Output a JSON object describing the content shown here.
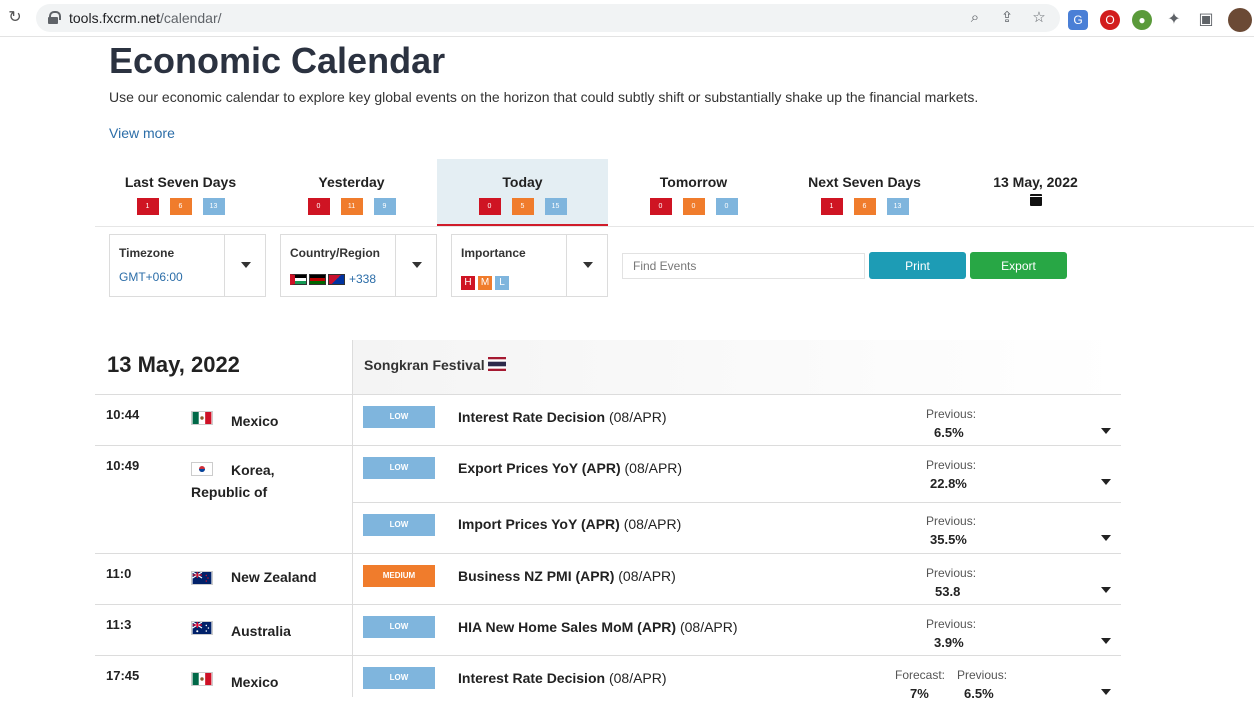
{
  "browser": {
    "url_host": "tools.fxcrm.net",
    "url_path": "/calendar/"
  },
  "page": {
    "title": "Economic Calendar",
    "intro": "Use our economic calendar to explore key global events on the horizon that could subtly shift or substantially shake up the financial markets.",
    "view_more": "View more"
  },
  "tabs": [
    {
      "label": "Last Seven Days",
      "high": "1",
      "medium": "6",
      "low": "13"
    },
    {
      "label": "Yesterday",
      "high": "0",
      "medium": "11",
      "low": "9"
    },
    {
      "label": "Today",
      "high": "0",
      "medium": "5",
      "low": "15",
      "active": true
    },
    {
      "label": "Tomorrow",
      "high": "0",
      "medium": "0",
      "low": "0"
    },
    {
      "label": "Next Seven Days",
      "high": "1",
      "medium": "6",
      "low": "13"
    },
    {
      "label": "13 May, 2022"
    }
  ],
  "filters": {
    "timezone_label": "Timezone",
    "timezone_value": "GMT+06:00",
    "country_label": "Country/Region",
    "country_more": "+338",
    "importance_label": "Importance",
    "importance_badges": [
      "H",
      "M",
      "L"
    ]
  },
  "search": {
    "placeholder": "Find Events"
  },
  "buttons": {
    "print": "Print",
    "export": "Export"
  },
  "calendar": {
    "date": "13 May, 2022",
    "holiday": "Songkran Festival"
  },
  "colors": {
    "high": "#cf1423",
    "medium": "#f07c2c",
    "low": "#7fb5dd",
    "accent_blue": "#2b6da8",
    "print": "#1d9cb5",
    "export": "#28a745"
  },
  "events": [
    {
      "time": "10:44",
      "country": "Mexico",
      "flag": "mexico-flag",
      "importance": "LOW",
      "name": "Interest Rate Decision",
      "period": "(08/APR)",
      "previous_label": "Previous:",
      "previous": "6.5%"
    },
    {
      "time": "10:49",
      "country": "Korea, Republic of",
      "flag": "korea-flag",
      "importance": "LOW",
      "name": "Export Prices YoY (APR)",
      "period": "(08/APR)",
      "previous_label": "Previous:",
      "previous": "22.8%"
    },
    {
      "time": "",
      "country": "",
      "flag": "",
      "importance": "LOW",
      "name": "Import Prices YoY (APR)",
      "period": "(08/APR)",
      "previous_label": "Previous:",
      "previous": "35.5%"
    },
    {
      "time": "11:0",
      "country": "New Zealand",
      "flag": "new-zealand-flag",
      "importance": "MEDIUM",
      "name": "Business NZ PMI (APR)",
      "period": "(08/APR)",
      "previous_label": "Previous:",
      "previous": "53.8"
    },
    {
      "time": "11:3",
      "country": "Australia",
      "flag": "australia-flag",
      "importance": "LOW",
      "name": "HIA New Home Sales MoM (APR)",
      "period": "(08/APR)",
      "previous_label": "Previous:",
      "previous": "3.9%"
    },
    {
      "time": "17:45",
      "country": "Mexico",
      "flag": "mexico-flag",
      "importance": "LOW",
      "name": "Interest Rate Decision",
      "period": "(08/APR)",
      "forecast_label": "Forecast:",
      "forecast": "7%",
      "previous_label": "Previous:",
      "previous": "6.5%"
    }
  ]
}
